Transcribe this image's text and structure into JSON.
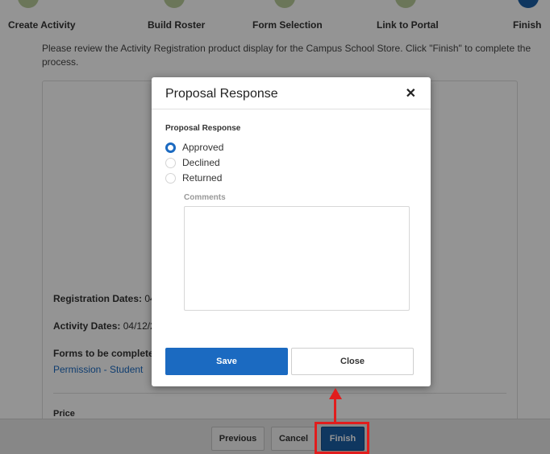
{
  "wizard": {
    "steps": [
      {
        "label": "Create Activity"
      },
      {
        "label": "Build Roster"
      },
      {
        "label": "Form Selection"
      },
      {
        "label": "Link to Portal"
      },
      {
        "label": "Finish"
      }
    ]
  },
  "instructions": "Please review the Activity Registration product display for the Campus School Store. Click \"Finish\" to complete the process.",
  "product": {
    "registration_dates_label": "Registration Dates:",
    "registration_dates_value": "04",
    "activity_dates_label": "Activity Dates:",
    "activity_dates_value": "04/12/2",
    "forms_label": "Forms to be completed",
    "form_link": "Permission - Student",
    "price_label": "Price"
  },
  "footer": {
    "previous": "Previous",
    "cancel": "Cancel",
    "finish": "Finish"
  },
  "modal": {
    "title": "Proposal Response",
    "close_icon": "close-icon",
    "section_label": "Proposal Response",
    "options": [
      {
        "label": "Approved",
        "checked": true
      },
      {
        "label": "Declined",
        "checked": false
      },
      {
        "label": "Returned",
        "checked": false
      }
    ],
    "comments_label": "Comments",
    "comments_value": "",
    "save": "Save",
    "close": "Close"
  },
  "colors": {
    "primary": "#1b6ac1",
    "finish_button": "#1b5fa6",
    "step_done": "#b9cc9a",
    "annotation": "#e11d1d"
  }
}
